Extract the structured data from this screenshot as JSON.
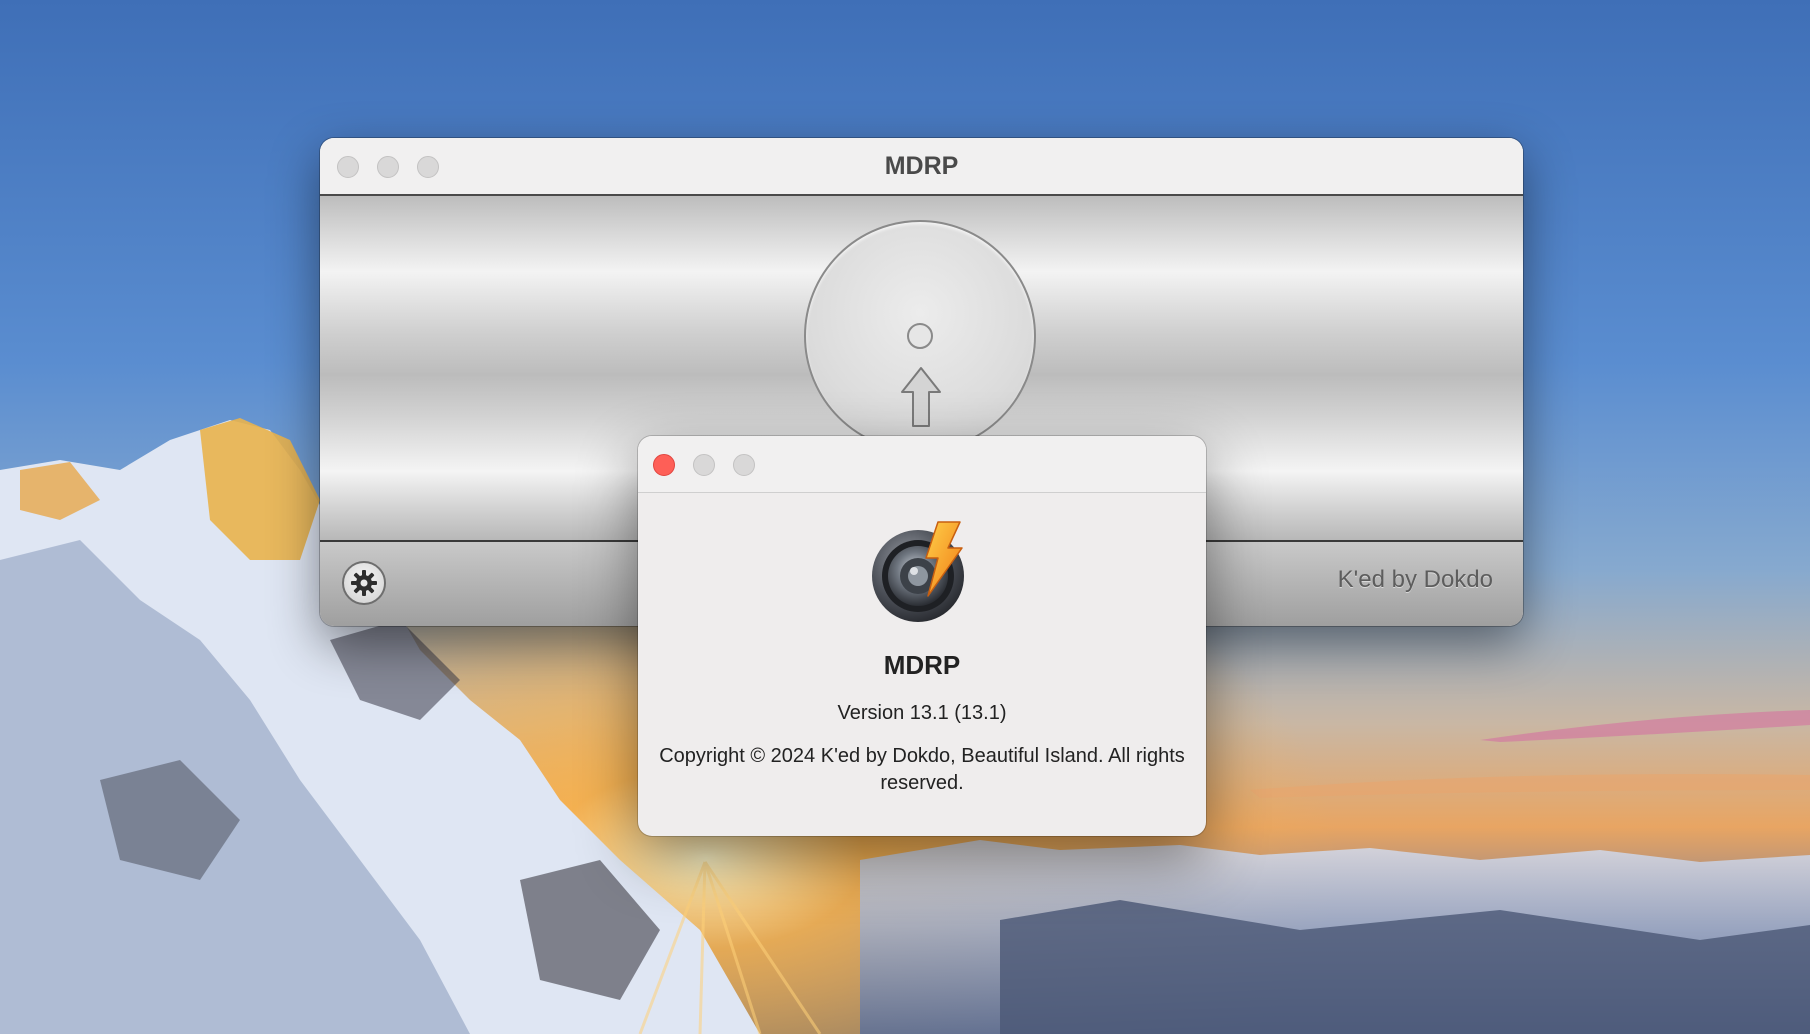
{
  "main_window": {
    "title": "MDRP",
    "credit": "K'ed by Dokdo",
    "settings_icon": "gear-icon",
    "drop_icon": "disc-with-up-arrow-icon"
  },
  "about_window": {
    "app_icon": "mdrp-lens-bolt-icon",
    "app_name": "MDRP",
    "version": "Version 13.1 (13.1)",
    "copyright": "Copyright © 2024 K'ed by Dokdo, Beautiful Island. All rights reserved."
  },
  "colors": {
    "close_button": "#fe5f57",
    "inactive_button": "#d9d8d8"
  }
}
